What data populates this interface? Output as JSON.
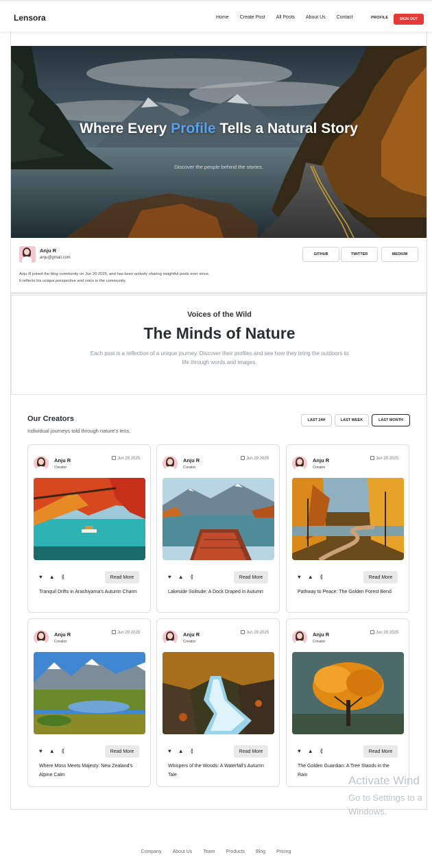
{
  "nav": {
    "brand": "Lensora",
    "links": [
      "Home",
      "Create Post",
      "All Posts",
      "About Us",
      "Contact"
    ],
    "profile": "PROFILE",
    "signout": "SIGN OUT",
    "signout_color": "#e53935"
  },
  "hero": {
    "title_pre": "Where Every ",
    "title_highlight": "Profile",
    "title_post": " Tells a Natural Story",
    "subtitle": "Discover the people behind the stories.",
    "highlight_color": "#5aa0ea"
  },
  "profile": {
    "name": "Anju R",
    "email": "anju@gmail.com",
    "bio_line1": "Anju R joined the blog community on Jun 20 2025, and has been actively sharing insightful posts ever since.",
    "bio_line2": "It reflects his unique perspective and voice in the community.",
    "links": [
      "GITHUB",
      "TWITTER",
      "MEDIUM"
    ]
  },
  "voices": {
    "kicker": "Voices of the Wild",
    "title": "The Minds of Nature",
    "description": "Each post is a reflection of a unique journey. Discover their profiles and see how they bring the outdoors to life through words and images."
  },
  "creators": {
    "title": "Our Creators",
    "subtitle": "Individual journeys told through nature's lens.",
    "filters": [
      "LAST 24H",
      "LAST WEEK",
      "LAST MONTH"
    ],
    "active_filter": "LAST MONTH",
    "read_more": "Read More",
    "cards": [
      {
        "author": "Anju R",
        "role": "Creator",
        "date": "Jun 29 2025",
        "caption": "Tranquil Drifts in Arashiyama's Autumn Charm"
      },
      {
        "author": "Anju R",
        "role": "Creator",
        "date": "Jun 29 2025",
        "caption": "Lakeside Solitude: A Dock Draped in Autumn"
      },
      {
        "author": "Anju R",
        "role": "Creator",
        "date": "Jun 29 2025",
        "caption": "Pathway to Peace: The Golden Forest Bend"
      },
      {
        "author": "Anju R",
        "role": "Creator",
        "date": "Jun 29 2025",
        "caption": "Where Moss Meets Majesty: New Zealand's Alpine Calm"
      },
      {
        "author": "Anju R",
        "role": "Creator",
        "date": "Jun 29 2025",
        "caption": "Whispers of the Woods: A Waterfall's Autumn Tale"
      },
      {
        "author": "Anju R",
        "role": "Creator",
        "date": "Jun 29 2025",
        "caption": "The Golden Guardian: A Tree Stands in the Rain"
      }
    ]
  },
  "watermark": {
    "line1": "Activate Wind",
    "line2": "Go to Settings to a",
    "line3": "Windows."
  },
  "footer": {
    "links": [
      "Company",
      "About Us",
      "Team",
      "Products",
      "Blog",
      "Pricing"
    ]
  }
}
